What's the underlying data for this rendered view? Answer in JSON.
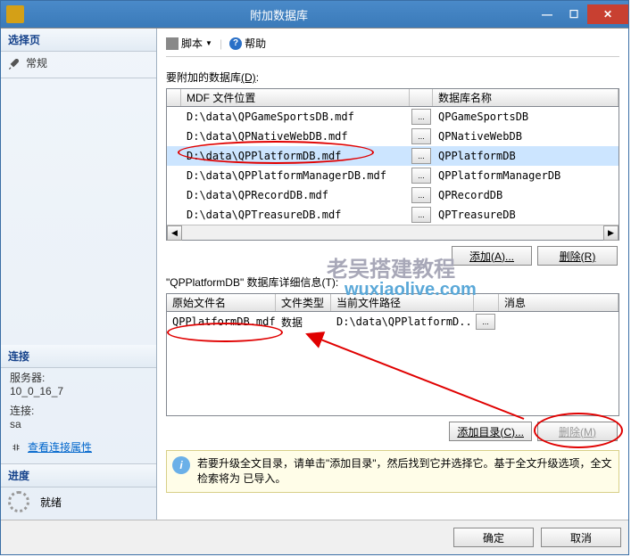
{
  "window": {
    "title": "附加数据库",
    "min_icon": "—",
    "max_icon": "☐",
    "close_icon": "✕"
  },
  "sidebar": {
    "select_page": "选择页",
    "general": "常规",
    "connection": "连接",
    "server_label": "服务器:",
    "server_value": "10_0_16_7",
    "conn_label": "连接:",
    "conn_value": "sa",
    "view_props": "查看连接属性",
    "progress": "进度",
    "ready": "就绪"
  },
  "toolbar": {
    "script": "脚本",
    "dropdown": "▼",
    "help": "帮助",
    "help_glyph": "?"
  },
  "attach": {
    "label_prefix": "要附加的数据库",
    "label_key": "(D)",
    "label_suffix": ":",
    "col_mdf": "MDF 文件位置",
    "col_dbname": "数据库名称",
    "rows": [
      {
        "mdf": "D:\\data\\QPGameSportsDB.mdf",
        "db": "QPGameSportsDB"
      },
      {
        "mdf": "D:\\data\\QPNativeWebDB.mdf",
        "db": "QPNativeWebDB"
      },
      {
        "mdf": "D:\\data\\QPPlatformDB.mdf",
        "db": "QPPlatformDB"
      },
      {
        "mdf": "D:\\data\\QPPlatformManagerDB.mdf",
        "db": "QPPlatformManagerDB"
      },
      {
        "mdf": "D:\\data\\QPRecordDB.mdf",
        "db": "QPRecordDB"
      },
      {
        "mdf": "D:\\data\\QPTreasureDB.mdf",
        "db": "QPTreasureDB"
      }
    ],
    "ellipsis": "...",
    "add_btn": "添加(A)...",
    "remove_btn": "删除(R)"
  },
  "details": {
    "label": "\"QPPlatformDB\" 数据库详细信息(T):",
    "col_orig": "原始文件名",
    "col_type": "文件类型",
    "col_path": "当前文件路径",
    "col_msg": "消息",
    "rows": [
      {
        "orig": "QPPlatformDB.mdf",
        "type": "数据",
        "path": "D:\\data\\QPPlatformD..."
      }
    ],
    "add_dir_btn": "添加目录(C)...",
    "remove_m_btn": "删除(M)"
  },
  "info": {
    "text": "若要升级全文目录，请单击\"添加目录\"，然后找到它并选择它。基于全文升级选项，全文检索将为 已导入。"
  },
  "footer": {
    "ok": "确定",
    "cancel": "取消"
  },
  "watermark1": "老吴搭建教程",
  "watermark2": "wuxiaolive.com"
}
